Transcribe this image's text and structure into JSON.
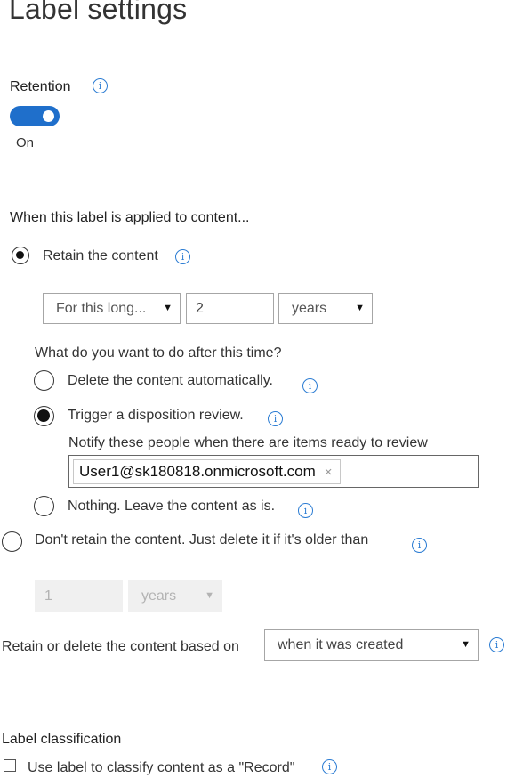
{
  "page_title": "Label settings",
  "retention": {
    "label": "Retention",
    "toggle_state": "On",
    "toggle_on": true
  },
  "applied_section": {
    "heading": "When this label is applied to content...",
    "retain_option": "Retain the content",
    "duration_select": "For this long...",
    "duration_value": "2",
    "duration_unit": "years",
    "after_question": "What do you want to do after this time?",
    "delete_option": "Delete the content automatically.",
    "disposition_option": "Trigger a disposition review.",
    "notify_label": "Notify these people when there are items ready to review",
    "notify_person": "User1@sk180818.onmicrosoft.com",
    "remove_glyph": "×",
    "nothing_option": "Nothing. Leave the content as is.",
    "dont_retain_option": "Don't retain the content. Just delete it if it's older than",
    "delete_age_value": "1",
    "delete_age_unit": "years",
    "based_on_label": "Retain or delete the content based on",
    "based_on_value": "when it was created"
  },
  "classification": {
    "heading": "Label classification",
    "record_checkbox_label": "Use label to classify content as a \"Record\""
  },
  "icons": {
    "info": "i",
    "dropdown": "▼"
  },
  "colors": {
    "accent": "#1f6fcb",
    "info_icon": "#2b7cd3"
  }
}
